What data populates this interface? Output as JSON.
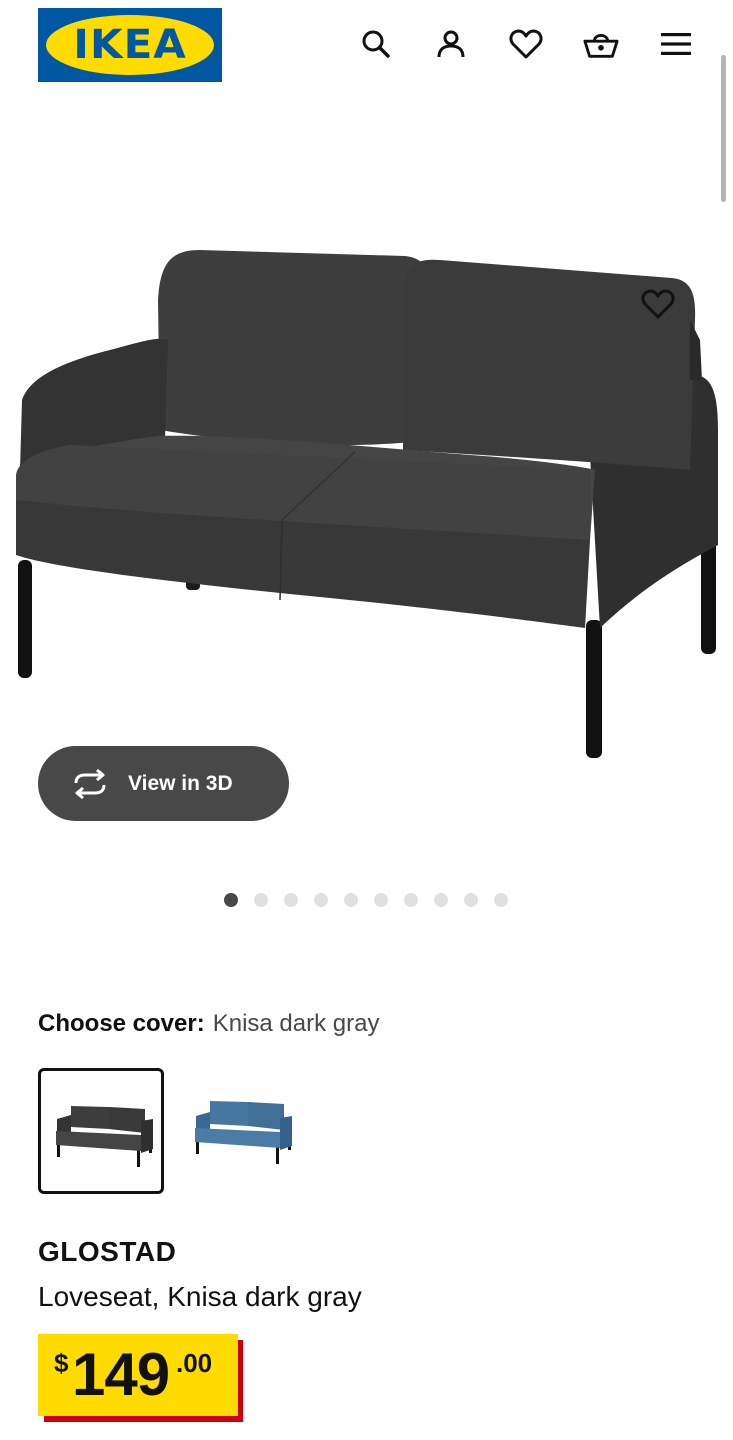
{
  "brand": {
    "logo_text": "IKEA",
    "colors": {
      "blue": "#0058a3",
      "yellow": "#ffdb00",
      "price_shadow": "#cc0008"
    }
  },
  "header": {
    "icons": [
      "search-icon",
      "account-icon",
      "favorites-heart-icon",
      "shopping-basket-icon",
      "menu-hamburger-icon"
    ]
  },
  "gallery": {
    "view_3d_label": "View in 3D",
    "dot_count": 10,
    "active_index": 0
  },
  "product": {
    "choose_cover_label": "Choose cover:",
    "selected_cover": "Knisa dark gray",
    "cover_options": [
      {
        "color": "#3a3a3a",
        "selected": true
      },
      {
        "color": "#3f6b8f",
        "selected": false
      }
    ],
    "name": "GLOSTAD",
    "description": "Loveseat, Knisa dark gray",
    "price": {
      "currency": "$",
      "integer": "149",
      "decimal": ".00"
    }
  }
}
